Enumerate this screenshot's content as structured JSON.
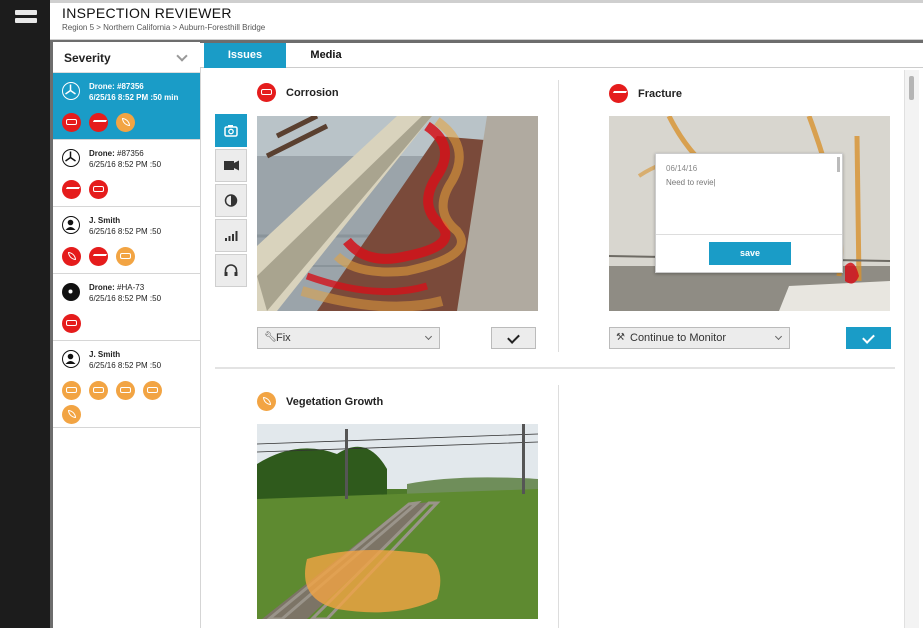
{
  "app": {
    "title": "INSPECTION REVIEWER",
    "breadcrumb": "Region 5 > Northern California > Auburn-Foresthill Bridge"
  },
  "sidebar": {
    "filter_label": "Severity",
    "cards": [
      {
        "who": "Drone:",
        "id": "#87356",
        "when": "6/25/16  8:52 PM  :50 min",
        "avatar": "drone-icon",
        "icons": [
          "corrosion-icon",
          "fracture-icon",
          "vegetation-icon"
        ]
      },
      {
        "who": "Drone:",
        "id": "#87356",
        "when": "6/25/16  8:52 PM  :50",
        "avatar": "drone-icon",
        "icons": [
          "fracture-icon",
          "corrosion-icon"
        ]
      },
      {
        "who": "J. Smith",
        "id": "",
        "when": "6/25/16  8:52 PM  :50",
        "avatar": "person-icon",
        "icons": [
          "vegetation-icon",
          "fracture-icon",
          "corrosion-icon"
        ]
      },
      {
        "who": "Drone:",
        "id": "#HA-73",
        "when": "6/25/16  8:52 PM  :50",
        "avatar": "gear-drone-icon",
        "icons": [
          "corrosion-icon"
        ]
      },
      {
        "who": "J. Smith",
        "id": "",
        "when": "6/25/16  8:52 PM  :50",
        "avatar": "person-icon",
        "icons": [
          "corrosion-icon",
          "corrosion-icon",
          "corrosion-icon",
          "corrosion-icon",
          "vegetation-icon"
        ]
      }
    ]
  },
  "tabs": {
    "issues": "Issues",
    "media": "Media"
  },
  "tools": [
    "camera-icon",
    "video-icon",
    "contrast-icon",
    "signal-icon",
    "audio-icon"
  ],
  "issues": {
    "corrosion": {
      "title": "Corrosion",
      "action": "Fix"
    },
    "fracture": {
      "title": "Fracture",
      "action": "Continue to Monitor",
      "note_date": "06/14/16",
      "note_text": "Need to revie|",
      "save_label": "save"
    },
    "vegetation": {
      "title": "Vegetation Growth"
    }
  },
  "colors": {
    "accent": "#1a9cc7",
    "severe": "#e51c1c",
    "moderate": "#f2a443"
  }
}
